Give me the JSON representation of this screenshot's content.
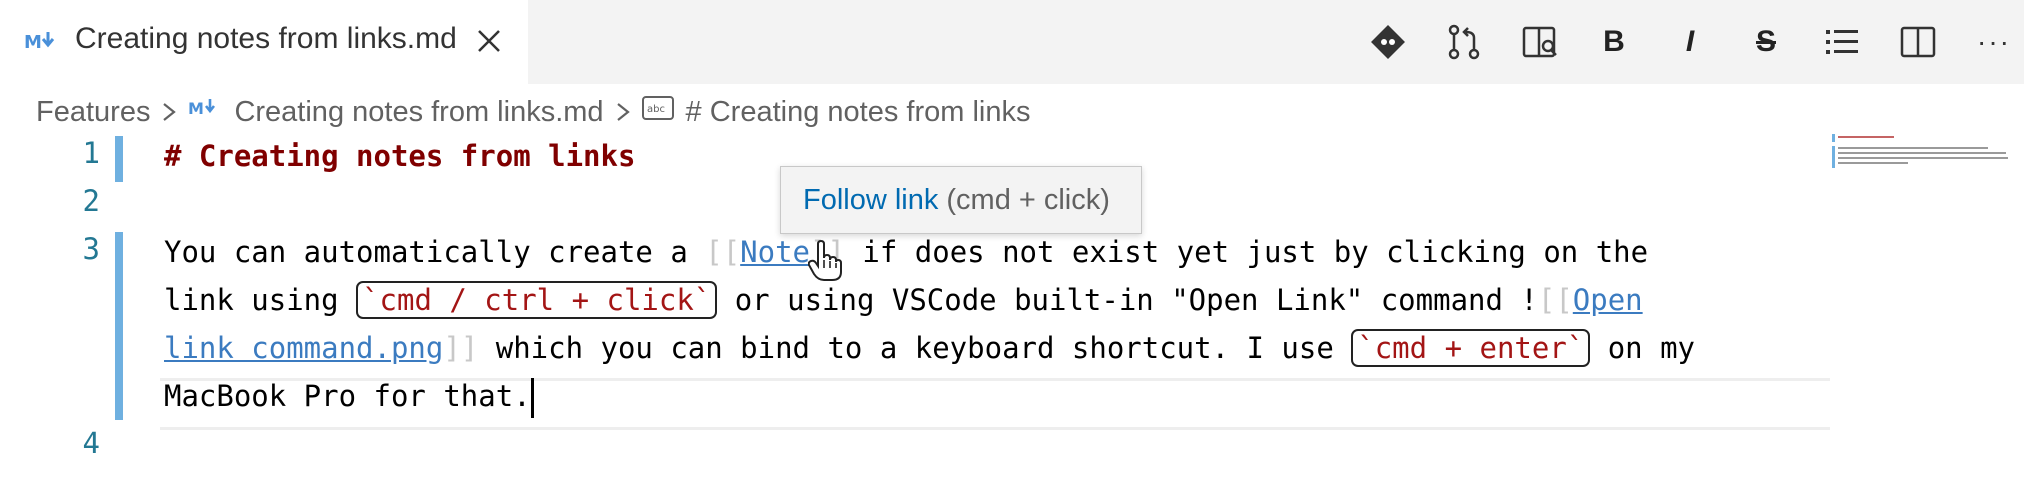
{
  "tab": {
    "title": "Creating notes from links.md",
    "icon": "markdown-icon",
    "close_icon": "close-icon"
  },
  "toolbar": [
    {
      "name": "git-compare-icon",
      "label": ""
    },
    {
      "name": "source-control-icon",
      "label": ""
    },
    {
      "name": "open-preview-side-icon",
      "label": ""
    },
    {
      "name": "bold-icon",
      "label": "B"
    },
    {
      "name": "italic-icon",
      "label": "I"
    },
    {
      "name": "strikethrough-icon",
      "label": "S"
    },
    {
      "name": "list-icon",
      "label": ""
    },
    {
      "name": "split-editor-icon",
      "label": ""
    },
    {
      "name": "more-actions-icon",
      "label": "···"
    }
  ],
  "breadcrumb": {
    "items": [
      "Features",
      "Creating notes from links.md",
      "# Creating notes from links"
    ],
    "icons": [
      "",
      "markdown-icon",
      "symbol-string-icon"
    ]
  },
  "editor": {
    "line_numbers": [
      "1",
      "2",
      "3",
      "4"
    ],
    "line1": {
      "heading": "# Creating notes from links"
    },
    "line3": {
      "seg1": "You can automatically create a ",
      "open_brackets": "[[",
      "note_link": "Note",
      "close_brackets": "]]",
      "seg2": " if does not exist yet just by clicking on the",
      "seg3": "link using ",
      "code1": "`cmd / ctrl + click`",
      "seg4": " or using VSCode built-in \"Open Link\" command !",
      "open_brackets2": "[[",
      "open_link_part1": "Open",
      "open_link_part2": "link command.png",
      "close_brackets2": "]]",
      "seg5": " which you can bind to a keyboard shortcut. I use ",
      "code2": "`cmd + enter`",
      "seg6": " on my",
      "seg7": "MacBook Pro for that."
    }
  },
  "hover": {
    "link_text": "Follow link",
    "hint_text": "(cmd + click)"
  },
  "colors": {
    "heading": "#800000",
    "link": "#3b7bc0",
    "code": "#a31515",
    "line_number": "#237893",
    "modified_indicator": "#6fb0e0"
  }
}
